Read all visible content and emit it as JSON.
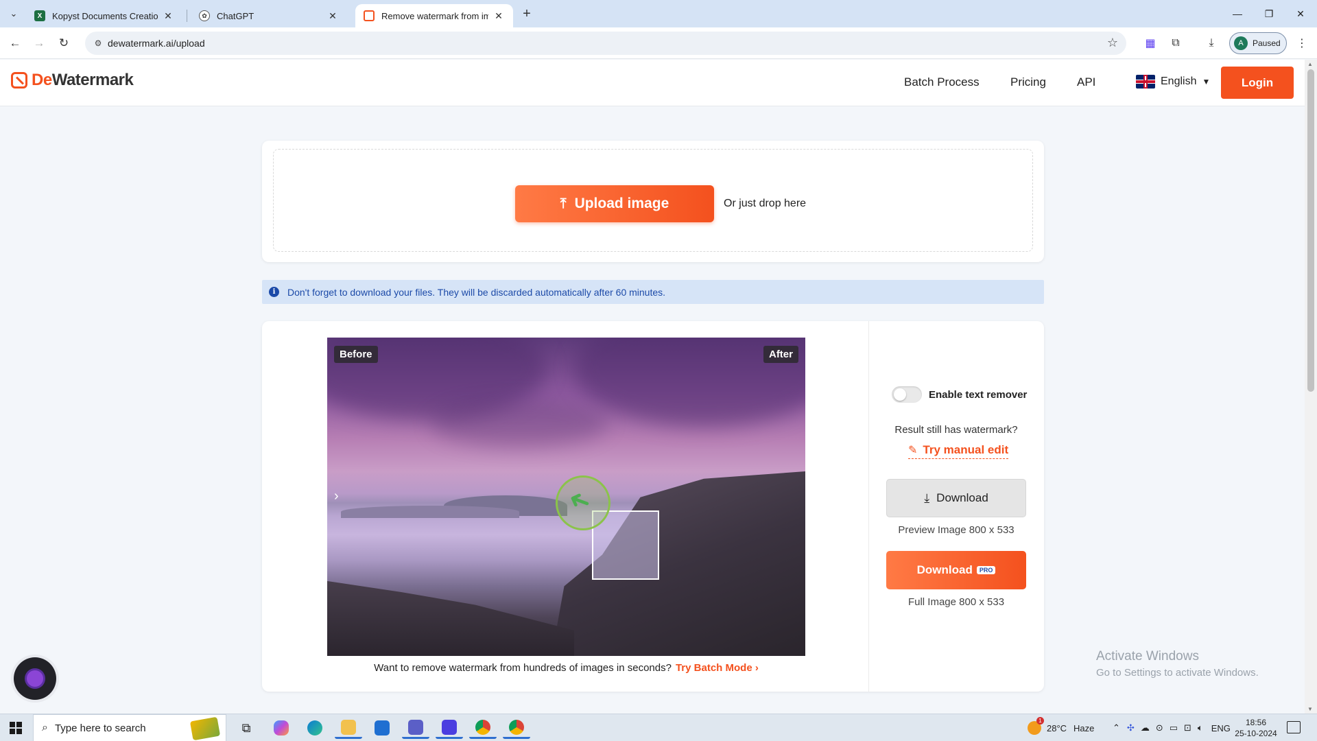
{
  "browser": {
    "tabs": [
      {
        "title": "Kopyst Documents Creation.xlsx",
        "icon": "excel-icon",
        "color": "#1d6f42"
      },
      {
        "title": "ChatGPT",
        "icon": "chatgpt-icon",
        "color": "#333333"
      },
      {
        "title": "Remove watermark from image",
        "icon": "dewatermark-icon",
        "color": "#f4511e"
      }
    ],
    "url": "dewatermark.ai/upload",
    "profile_initial": "A",
    "profile_label": "Paused"
  },
  "site": {
    "logo_prefix": "De",
    "logo_suffix": "Watermark",
    "nav": [
      "Batch Process",
      "Pricing",
      "API"
    ],
    "language": "English",
    "login_label": "Login",
    "accent_color": "#f4511e"
  },
  "upload": {
    "button_label": "Upload image",
    "drop_text": "Or just drop here"
  },
  "notice": {
    "text": "Don't forget to download your files. They will be discarded automatically after 60 minutes."
  },
  "result": {
    "before_label": "Before",
    "after_label": "After",
    "batch_prompt": "Want to remove watermark from hundreds of images in seconds?",
    "batch_link": "Try Batch Mode",
    "text_remover_label": "Enable text remover",
    "text_remover_enabled": false,
    "still_watermark": "Result still has watermark?",
    "manual_edit": "Try manual edit",
    "download_label": "Download",
    "preview_caption": "Preview Image 800 x 533",
    "download_pro_label": "Download",
    "pro_badge": "PRO",
    "full_caption": "Full Image 800 x 533"
  },
  "windows": {
    "activate_title": "Activate Windows",
    "activate_sub": "Go to Settings to activate Windows.",
    "search_placeholder": "Type here to search",
    "temperature": "28°C",
    "weather": "Haze",
    "input_lang": "ENG",
    "time": "18:56",
    "date": "25-10-2024"
  }
}
